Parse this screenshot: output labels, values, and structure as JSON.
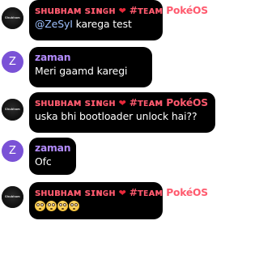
{
  "messages": [
    {
      "sender": "sʜuʙʜᴀᴍ sɪɴɢʜ",
      "sender_suffix": "#ᴛᴇᴀᴍ PokéOS",
      "avatar_text": "Shubham",
      "mention": "@ZeSyI",
      "text": "karega test"
    },
    {
      "sender": "zaman",
      "avatar_letter": "Z",
      "text": "Meri gaamd karegi"
    },
    {
      "sender": "sʜuʙʜᴀᴍ sɪɴɢʜ",
      "sender_suffix": "#ᴛᴇᴀᴍ PokéOS",
      "avatar_text": "Shubham",
      "text": "uska bhi bootloader unlock hai??"
    },
    {
      "sender": "zaman",
      "avatar_letter": "Z",
      "text": "Ofc"
    },
    {
      "sender": "sʜuʙʜᴀᴍ sɪɴɢʜ",
      "sender_suffix": "#ᴛᴇᴀᴍ PokéOS",
      "avatar_text": "Shubham",
      "emoji_icon": "flushed-face-icon",
      "emoji_count": 4
    }
  ],
  "colors": {
    "bubble": "#000000",
    "sender_shubham": "#ff5a6e",
    "sender_zaman": "#b48cff",
    "avatar_zaman": "#7a52d6",
    "heart": "#e8283a",
    "mention": "#9ec1ff"
  }
}
